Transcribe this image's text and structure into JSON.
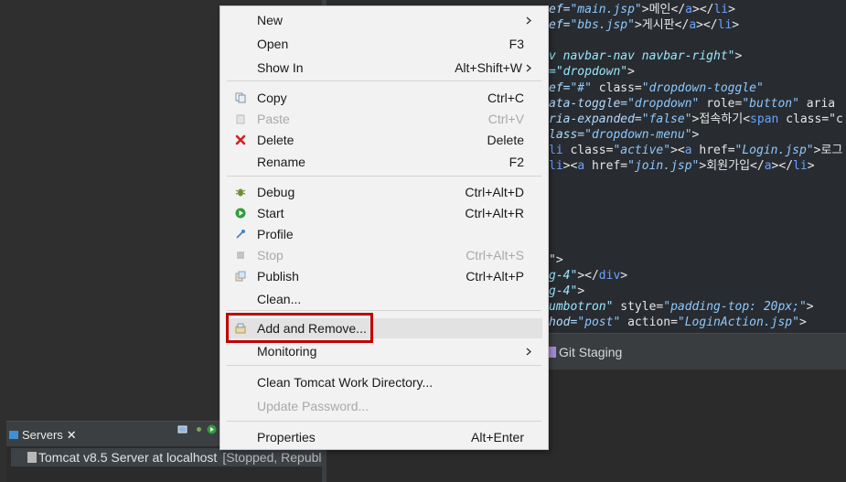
{
  "editor": {
    "lines": [
      [
        {
          "c": "tok-attr",
          "t": "ef="
        },
        {
          "c": "tok-str",
          "t": "\"main.jsp\""
        },
        {
          "c": "tok-b",
          "t": ">메인</"
        },
        {
          "c": "tok-tag",
          "t": "a"
        },
        {
          "c": "tok-b",
          "t": "></"
        },
        {
          "c": "tok-tag",
          "t": "li"
        },
        {
          "c": "tok-b",
          "t": ">"
        }
      ],
      [
        {
          "c": "tok-attr",
          "t": "ef="
        },
        {
          "c": "tok-str",
          "t": "\"bbs.jsp\""
        },
        {
          "c": "tok-b",
          "t": ">게시판</"
        },
        {
          "c": "tok-tag",
          "t": "a"
        },
        {
          "c": "tok-b",
          "t": "></"
        },
        {
          "c": "tok-tag",
          "t": "li"
        },
        {
          "c": "tok-b",
          "t": ">"
        }
      ],
      [],
      [
        {
          "c": "tok-str2",
          "t": "v navbar-nav navbar-right\""
        },
        {
          "c": "tok-b",
          "t": ">"
        }
      ],
      [
        {
          "c": "tok-str2",
          "t": "=\"dropdown\""
        },
        {
          "c": "tok-b",
          "t": ">"
        }
      ],
      [
        {
          "c": "tok-attr",
          "t": "ef="
        },
        {
          "c": "tok-str",
          "t": "\"#\""
        },
        {
          "c": "tok-b",
          "t": " class="
        },
        {
          "c": "tok-str",
          "t": "\"dropdown-toggle\""
        }
      ],
      [
        {
          "c": "tok-attr",
          "t": "ata-toggle="
        },
        {
          "c": "tok-str",
          "t": "\"dropdown\""
        },
        {
          "c": "tok-b",
          "t": " role="
        },
        {
          "c": "tok-str",
          "t": "\"button\""
        },
        {
          "c": "tok-b",
          "t": " aria"
        }
      ],
      [
        {
          "c": "tok-attr",
          "t": "ria-expanded="
        },
        {
          "c": "tok-str",
          "t": "\"false\""
        },
        {
          "c": "tok-b",
          "t": ">접속하기<"
        },
        {
          "c": "tok-tag",
          "t": "span"
        },
        {
          "c": "tok-b",
          "t": " class=\"c"
        }
      ],
      [
        {
          "c": "tok-attr",
          "t": "lass="
        },
        {
          "c": "tok-str",
          "t": "\"dropdown-menu\""
        },
        {
          "c": "tok-b",
          "t": ">"
        }
      ],
      [
        {
          "c": "tok-tag",
          "t": "li"
        },
        {
          "c": "tok-b",
          "t": " class="
        },
        {
          "c": "tok-str",
          "t": "\"active\""
        },
        {
          "c": "tok-b",
          "t": "><"
        },
        {
          "c": "tok-tag",
          "t": "a"
        },
        {
          "c": "tok-b",
          "t": " href="
        },
        {
          "c": "tok-str",
          "t": "\"Login.jsp\""
        },
        {
          "c": "tok-b",
          "t": ">로그"
        }
      ],
      [
        {
          "c": "tok-tag",
          "t": "li"
        },
        {
          "c": "tok-b",
          "t": "><"
        },
        {
          "c": "tok-tag",
          "t": "a"
        },
        {
          "c": "tok-b",
          "t": " href="
        },
        {
          "c": "tok-str",
          "t": "\"join.jsp\""
        },
        {
          "c": "tok-b",
          "t": ">회원가입</"
        },
        {
          "c": "tok-tag",
          "t": "a"
        },
        {
          "c": "tok-b",
          "t": "></"
        },
        {
          "c": "tok-tag",
          "t": "li"
        },
        {
          "c": "tok-b",
          "t": ">"
        }
      ],
      [],
      [],
      [],
      [],
      [],
      [
        {
          "c": "tok-b",
          "t": "\">"
        }
      ],
      [
        {
          "c": "tok-str2",
          "t": "g-4\""
        },
        {
          "c": "tok-b",
          "t": "></"
        },
        {
          "c": "tok-tag",
          "t": "div"
        },
        {
          "c": "tok-b",
          "t": ">"
        }
      ],
      [
        {
          "c": "tok-str2",
          "t": "g-4\""
        },
        {
          "c": "tok-b",
          "t": ">"
        }
      ],
      [
        {
          "c": "tok-str2",
          "t": "umbotron\""
        },
        {
          "c": "tok-b",
          "t": " style="
        },
        {
          "c": "tok-str",
          "t": "\"padding-top: 20px;\""
        },
        {
          "c": "tok-b",
          "t": ">"
        }
      ],
      [
        {
          "c": "tok-attr",
          "t": "hod="
        },
        {
          "c": "tok-str",
          "t": "\"post\""
        },
        {
          "c": "tok-b",
          "t": " action="
        },
        {
          "c": "tok-str",
          "t": "\"LoginAction.jsp\""
        },
        {
          "c": "tok-b",
          "t": ">"
        }
      ]
    ]
  },
  "git_panel": {
    "tab_label": "Git Staging"
  },
  "servers_panel": {
    "tab_label": "Servers",
    "close_glyph": "✕",
    "server_name": "Tomcat v8.5 Server at localhost",
    "server_status": "[Stopped, Republish]"
  },
  "context_menu": {
    "items": [
      {
        "id": "new",
        "label": "New",
        "shortcut": "",
        "submenu": true,
        "icon": "",
        "disabled": false
      },
      {
        "id": "open",
        "label": "Open",
        "shortcut": "F3",
        "submenu": false,
        "icon": "",
        "disabled": false
      },
      {
        "id": "show-in",
        "label": "Show In",
        "shortcut": "Alt+Shift+W",
        "submenu": true,
        "icon": "",
        "disabled": false
      },
      {
        "id": "copy",
        "label": "Copy",
        "shortcut": "Ctrl+C",
        "submenu": false,
        "icon": "copy-icon",
        "disabled": false
      },
      {
        "id": "paste",
        "label": "Paste",
        "shortcut": "Ctrl+V",
        "submenu": false,
        "icon": "paste-icon",
        "disabled": true
      },
      {
        "id": "delete",
        "label": "Delete",
        "shortcut": "Delete",
        "submenu": false,
        "icon": "delete-icon",
        "disabled": false
      },
      {
        "id": "rename",
        "label": "Rename",
        "shortcut": "F2",
        "submenu": false,
        "icon": "",
        "disabled": false
      },
      {
        "id": "debug",
        "label": "Debug",
        "shortcut": "Ctrl+Alt+D",
        "submenu": false,
        "icon": "debug-icon",
        "disabled": false
      },
      {
        "id": "start",
        "label": "Start",
        "shortcut": "Ctrl+Alt+R",
        "submenu": false,
        "icon": "start-icon",
        "disabled": false
      },
      {
        "id": "profile",
        "label": "Profile",
        "shortcut": "",
        "submenu": false,
        "icon": "profile-icon",
        "disabled": false
      },
      {
        "id": "stop",
        "label": "Stop",
        "shortcut": "Ctrl+Alt+S",
        "submenu": false,
        "icon": "stop-icon",
        "disabled": true
      },
      {
        "id": "publish",
        "label": "Publish",
        "shortcut": "Ctrl+Alt+P",
        "submenu": false,
        "icon": "publish-icon",
        "disabled": false
      },
      {
        "id": "clean",
        "label": "Clean...",
        "shortcut": "",
        "submenu": false,
        "icon": "",
        "disabled": false
      },
      {
        "id": "add-and-remove",
        "label": "Add and Remove...",
        "shortcut": "",
        "submenu": false,
        "icon": "add-remove-icon",
        "disabled": false,
        "highlighted": true
      },
      {
        "id": "monitoring",
        "label": "Monitoring",
        "shortcut": "",
        "submenu": true,
        "icon": "",
        "disabled": false
      },
      {
        "id": "clean-tomcat-work-directory",
        "label": "Clean Tomcat Work Directory...",
        "shortcut": "",
        "submenu": false,
        "icon": "",
        "disabled": false
      },
      {
        "id": "update-password",
        "label": "Update Password...",
        "shortcut": "",
        "submenu": false,
        "icon": "",
        "disabled": true
      },
      {
        "id": "properties",
        "label": "Properties",
        "shortcut": "Alt+Enter",
        "submenu": false,
        "icon": "",
        "disabled": false
      }
    ]
  },
  "colors": {
    "menu_background": "#f2f2f2",
    "highlight_border": "#c00000",
    "delete_icon": "#d32020",
    "start_icon": "#2e9e3e"
  }
}
